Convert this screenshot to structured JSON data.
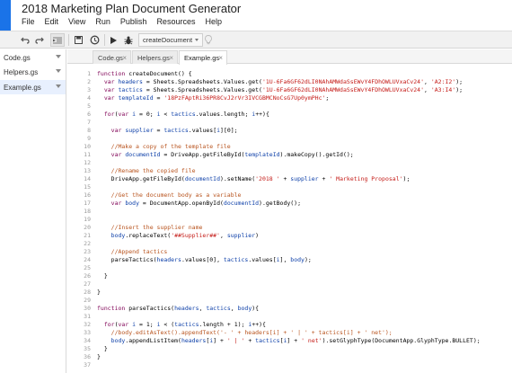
{
  "header": {
    "title": "2018 Marketing Plan Document Generator",
    "menu": [
      "File",
      "Edit",
      "View",
      "Run",
      "Publish",
      "Resources",
      "Help"
    ]
  },
  "toolbar": {
    "function_select": "createDocument"
  },
  "sidebar": {
    "files": [
      {
        "name": "Code.gs",
        "active": false
      },
      {
        "name": "Helpers.gs",
        "active": false
      },
      {
        "name": "Example.gs",
        "active": true
      }
    ]
  },
  "tabs": [
    {
      "name": "Code.gs",
      "active": false
    },
    {
      "name": "Helpers.gs",
      "active": false
    },
    {
      "name": "Example.gs",
      "active": true
    }
  ],
  "editor": {
    "line_numbers": [
      "1",
      "2",
      "3",
      "4",
      "5",
      "6",
      "7",
      "8",
      "9",
      "10",
      "11",
      "12",
      "13",
      "14",
      "15",
      "16",
      "17",
      "18",
      "19",
      "20",
      "21",
      "22",
      "23",
      "24",
      "25",
      "26",
      "27",
      "28",
      "29",
      "30",
      "31",
      "32",
      "33",
      "34",
      "35",
      "36",
      "37"
    ],
    "lines": [
      "function createDocument() {",
      "  var headers = Sheets.Spreadsheets.Values.get('1U-6Fa6GF62dLI0NAhAMWdaSsEWvY4FDhOWLUVxaCv24', 'A2:I2');",
      "  var tactics = Sheets.Spreadsheets.Values.get('1U-6Fa6GF62dLI0NAhAMWdaSsEWvY4FDhOWLUVxaCv24', 'A3:I4');",
      "  var templateId = '18PzFAptRi36PR8CvJ2rVr3IVCGBMCNoCsG7Up0ymPHc';",
      "",
      "  for(var i = 0; i < tactics.values.length; i++){",
      "",
      "    var supplier = tactics.values[i][0];",
      "",
      "    //Make a copy of the template file",
      "    var documentId = DriveApp.getFileById(templateId).makeCopy().getId();",
      "",
      "    //Rename the copied file",
      "    DriveApp.getFileById(documentId).setName('2018 ' + supplier + ' Marketing Proposal');",
      "",
      "    //Get the document body as a variable",
      "    var body = DocumentApp.openById(documentId).getBody();",
      "",
      "",
      "    //Insert the supplier name",
      "    body.replaceText('##Supplier##', supplier)",
      "",
      "    //Append tactics",
      "    parseTactics(headers.values[0], tactics.values[i], body);",
      "",
      "  }",
      "",
      "}",
      "",
      "function parseTactics(headers, tactics, body){",
      "",
      "  for(var i = 1; i < (tactics.length + 1); i++){",
      "    //body.editAsText().appendText('- ' + headers[i] + ' | ' + tactics[i] + ' net');",
      "    body.appendListItem(headers[i] + ' | ' + tactics[i] + ' net').setGlyphType(DocumentApp.GlyphType.BULLET);",
      "  }",
      "}",
      ""
    ]
  },
  "colors": {
    "keyword": "#7f0055",
    "variable": "#0b3ea8",
    "string": "#c41a16",
    "comment": "#b8531d",
    "logo": "#1a73e8"
  }
}
